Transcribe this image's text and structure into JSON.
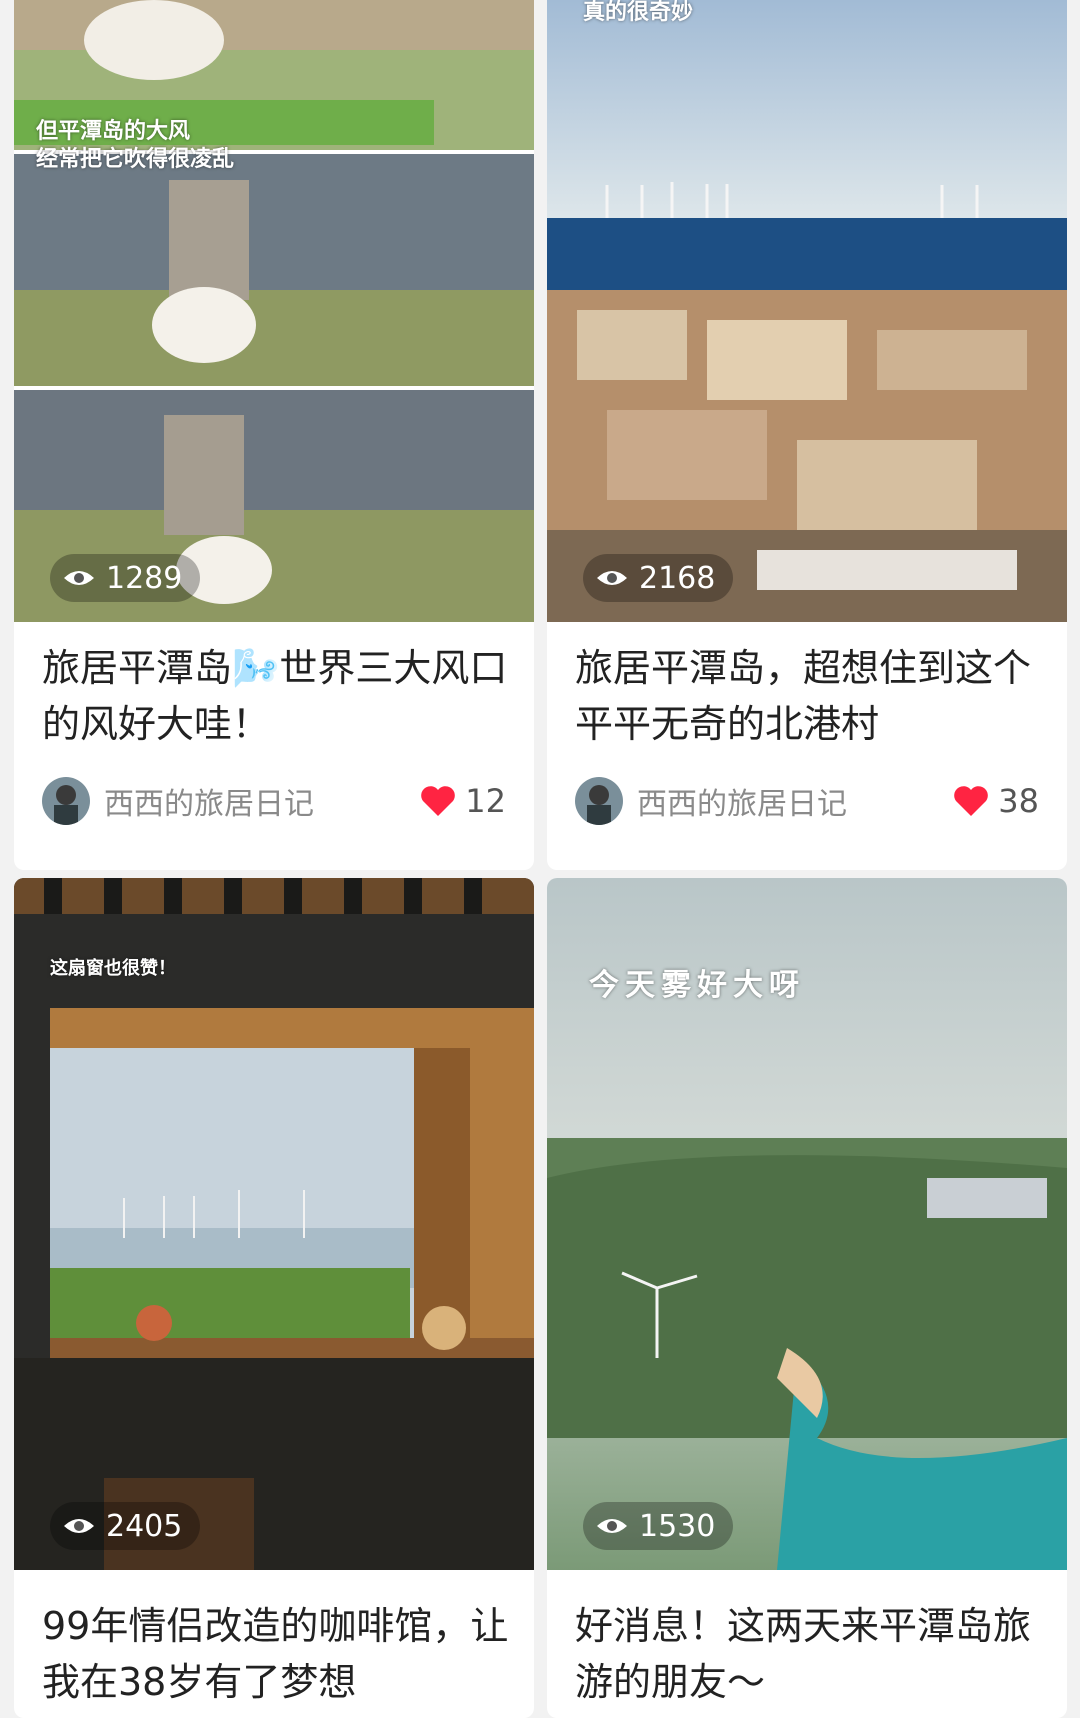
{
  "cards": [
    {
      "overlay_lines": [
        "但平潭岛的大风",
        "经常把它吹得很凌乱"
      ],
      "views": "1289",
      "title": "旅居平潭岛🌬️世界三大风口的风好大哇！",
      "author": "西西的旅居日记",
      "likes": "12"
    },
    {
      "overlay_lines": [
        "真的很奇妙"
      ],
      "views": "2168",
      "title": "旅居平潭岛，超想住到这个平平无奇的北港村",
      "author": "西西的旅居日记",
      "likes": "38"
    },
    {
      "overlay_lines": [
        "这扇窗也很赞！"
      ],
      "views": "2405",
      "title": "99年情侣改造的咖啡馆，让我在38岁有了梦想"
    },
    {
      "overlay_lines": [
        "今天雾好大呀"
      ],
      "views": "1530",
      "title": "好消息！这两天来平潭岛旅游的朋友～"
    }
  ],
  "icons": {
    "views": "eye-icon",
    "likes": "heart-icon"
  },
  "colors": {
    "like": "#ff2442",
    "background": "#f2f2f2"
  }
}
